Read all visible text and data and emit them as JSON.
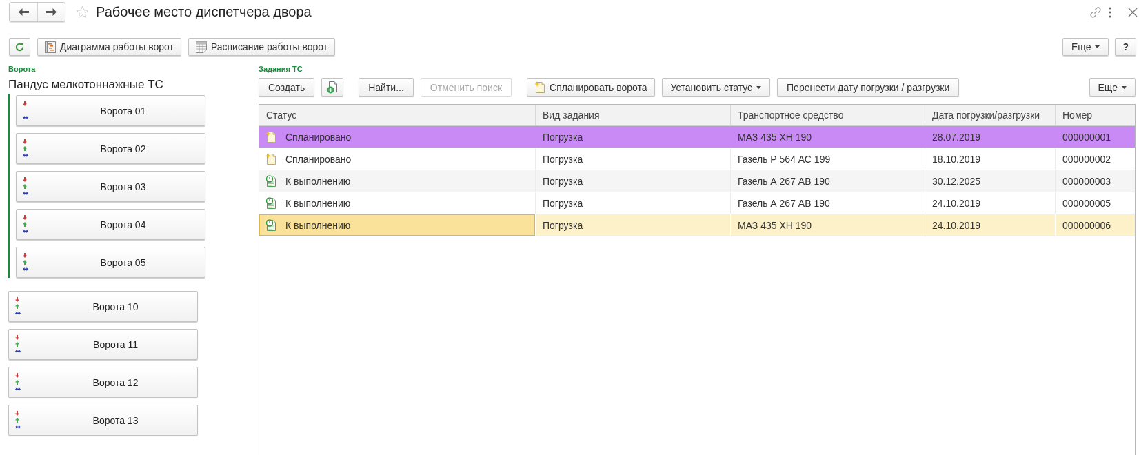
{
  "header": {
    "title": "Рабочее место диспетчера двора",
    "favorite": false
  },
  "toolbar": {
    "left": [
      {
        "kind": "icon"
      },
      {
        "kind": "icon_text",
        "label": "Диаграмма работы ворот"
      },
      {
        "kind": "icon_text",
        "label": "Расписание работы ворот"
      }
    ],
    "right": [
      {
        "kind": "menu",
        "label": "Еще"
      },
      {
        "kind": "text",
        "label": "?"
      }
    ]
  },
  "gates_panel": {
    "label": "Ворота",
    "groups": [
      {
        "title": "Пандус мелкотоннажные ТС",
        "gates": [
          {
            "name": "Ворота 01",
            "down_arrow": true,
            "up_arrow": false,
            "double_arrow": true
          },
          {
            "name": "Ворота 02",
            "down_arrow": true,
            "up_arrow": true,
            "double_arrow": true
          },
          {
            "name": "Ворота 03",
            "down_arrow": true,
            "up_arrow": true,
            "double_arrow": true
          },
          {
            "name": "Ворота 04",
            "down_arrow": true,
            "up_arrow": true,
            "double_arrow": true
          },
          {
            "name": "Ворота 05",
            "down_arrow": true,
            "up_arrow": true,
            "double_arrow": true
          }
        ]
      }
    ],
    "gates": [
      {
        "name": "Ворота 10",
        "down_arrow": true,
        "up_arrow": true,
        "double_arrow": true
      },
      {
        "name": "Ворота 11",
        "down_arrow": true,
        "up_arrow": true,
        "double_arrow": true
      },
      {
        "name": "Ворота 12",
        "down_arrow": true,
        "up_arrow": true,
        "double_arrow": true
      },
      {
        "name": "Ворота 13",
        "down_arrow": true,
        "up_arrow": true,
        "double_arrow": true
      }
    ]
  },
  "tasks_panel": {
    "label": "Задания ТС",
    "button_groups": [
      [
        {
          "kind": "text",
          "label": "Создать",
          "disabled": false
        },
        {
          "kind": "icon",
          "disabled": false
        }
      ],
      [
        {
          "kind": "text",
          "label": "Найти...",
          "disabled": false
        },
        {
          "kind": "text",
          "label": "Отменить поиск",
          "disabled": true
        }
      ],
      [
        {
          "kind": "icon_text",
          "label": "Спланировать ворота",
          "disabled": false
        },
        {
          "kind": "menu",
          "label": "Установить статус",
          "disabled": false
        },
        {
          "kind": "text",
          "label": "Перенести дату погрузки / разгрузки",
          "disabled": false
        }
      ]
    ],
    "more": {
      "kind": "menu",
      "label": "Еще"
    },
    "table": {
      "columns": [
        "Статус",
        "Вид задания",
        "Транспортное средство",
        "Дата погрузки/разгрузки",
        "Номер"
      ],
      "rows": [
        {
          "kind": "planned",
          "cells": [
            "Спланировано",
            "Погрузка",
            "МАЗ 435 ХН 190",
            "28.07.2019",
            "000000001"
          ],
          "color": "#c98af6",
          "selected": false
        },
        {
          "kind": "planned",
          "cells": [
            "Спланировано",
            "Погрузка",
            "Газель Р 564 АС 199",
            "18.10.2019",
            "000000002"
          ],
          "selected": false
        },
        {
          "kind": "ready",
          "cells": [
            "К выполнению",
            "Погрузка",
            "Газель А 267 АВ 190",
            "30.12.2025",
            "000000003"
          ],
          "selected": false
        },
        {
          "kind": "ready",
          "cells": [
            "К выполнению",
            "Погрузка",
            "Газель А 267 АВ 190",
            "24.10.2019",
            "000000005"
          ],
          "selected": false
        },
        {
          "kind": "ready",
          "cells": [
            "К выполнению",
            "Погрузка",
            "МАЗ 435 ХН 190",
            "24.10.2019",
            "000000006"
          ],
          "selected": true
        }
      ]
    }
  }
}
